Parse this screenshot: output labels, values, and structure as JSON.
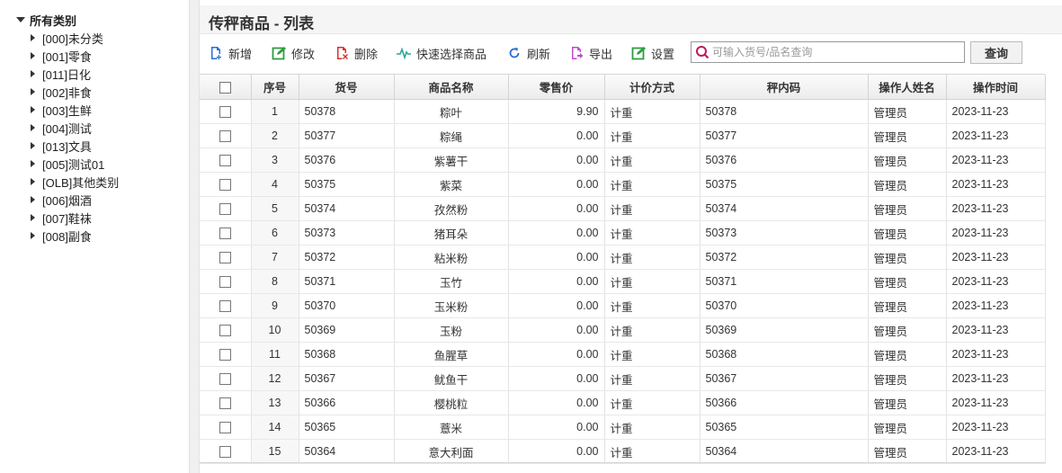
{
  "tree": {
    "root_label": "所有类别",
    "items": [
      {
        "label": "[000]未分类"
      },
      {
        "label": "[001]零食"
      },
      {
        "label": "[011]日化"
      },
      {
        "label": "[002]非食"
      },
      {
        "label": "[003]生鲜"
      },
      {
        "label": "[004]测试"
      },
      {
        "label": "[013]文具"
      },
      {
        "label": "[005]测试01"
      },
      {
        "label": "[OLB]其他类别"
      },
      {
        "label": "[006]烟酒"
      },
      {
        "label": "[007]鞋袜"
      },
      {
        "label": "[008]副食"
      }
    ]
  },
  "title": "传秤商品 - 列表",
  "toolbar": {
    "add": "新增",
    "edit": "修改",
    "delete": "删除",
    "quick_select": "快速选择商品",
    "refresh": "刷新",
    "export": "导出",
    "settings": "设置",
    "search_placeholder": "可输入货号/品名查询",
    "query": "查询"
  },
  "colors": {
    "add_icon": "#2b6fd6",
    "edit_icon": "#2e9e3e",
    "delete_icon": "#d9312b",
    "quick_icon": "#2aa6a0",
    "refresh_icon": "#2b6fd6",
    "export_icon": "#c04ad0",
    "settings_icon": "#2e9e3e",
    "search_icon": "#c2185b"
  },
  "table": {
    "headers": [
      "序号",
      "货号",
      "商品名称",
      "零售价",
      "计价方式",
      "秤内码",
      "操作人姓名",
      "操作时间"
    ],
    "rows": [
      [
        "1",
        "50378",
        "粽叶",
        "9.90",
        "计重",
        "50378",
        "管理员",
        "2023-11-23"
      ],
      [
        "2",
        "50377",
        "粽绳",
        "0.00",
        "计重",
        "50377",
        "管理员",
        "2023-11-23"
      ],
      [
        "3",
        "50376",
        "紫薯干",
        "0.00",
        "计重",
        "50376",
        "管理员",
        "2023-11-23"
      ],
      [
        "4",
        "50375",
        "紫菜",
        "0.00",
        "计重",
        "50375",
        "管理员",
        "2023-11-23"
      ],
      [
        "5",
        "50374",
        "孜然粉",
        "0.00",
        "计重",
        "50374",
        "管理员",
        "2023-11-23"
      ],
      [
        "6",
        "50373",
        "猪耳朵",
        "0.00",
        "计重",
        "50373",
        "管理员",
        "2023-11-23"
      ],
      [
        "7",
        "50372",
        "粘米粉",
        "0.00",
        "计重",
        "50372",
        "管理员",
        "2023-11-23"
      ],
      [
        "8",
        "50371",
        "玉竹",
        "0.00",
        "计重",
        "50371",
        "管理员",
        "2023-11-23"
      ],
      [
        "9",
        "50370",
        "玉米粉",
        "0.00",
        "计重",
        "50370",
        "管理员",
        "2023-11-23"
      ],
      [
        "10",
        "50369",
        "玉粉",
        "0.00",
        "计重",
        "50369",
        "管理员",
        "2023-11-23"
      ],
      [
        "11",
        "50368",
        "鱼腥草",
        "0.00",
        "计重",
        "50368",
        "管理员",
        "2023-11-23"
      ],
      [
        "12",
        "50367",
        "鱿鱼干",
        "0.00",
        "计重",
        "50367",
        "管理员",
        "2023-11-23"
      ],
      [
        "13",
        "50366",
        "樱桃粒",
        "0.00",
        "计重",
        "50366",
        "管理员",
        "2023-11-23"
      ],
      [
        "14",
        "50365",
        "薏米",
        "0.00",
        "计重",
        "50365",
        "管理员",
        "2023-11-23"
      ],
      [
        "15",
        "50364",
        "意大利面",
        "0.00",
        "计重",
        "50364",
        "管理员",
        "2023-11-23"
      ]
    ]
  }
}
